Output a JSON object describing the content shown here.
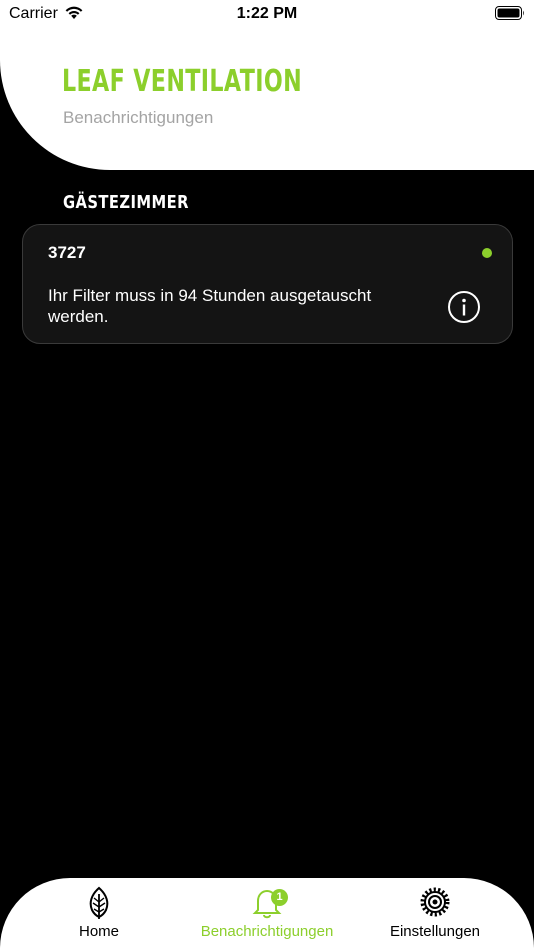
{
  "status_bar": {
    "carrier": "Carrier",
    "time": "1:22 PM"
  },
  "header": {
    "title": "LEAF VENTILATION",
    "subtitle": "Benachrichtigungen"
  },
  "section": {
    "title": "GÄSTEZIMMER"
  },
  "notifications": [
    {
      "device_id": "3727",
      "message": "Ihr Filter muss in 94 Stunden ausgetauscht werden.",
      "status_color": "#8ccf2c"
    }
  ],
  "tabbar": {
    "tabs": [
      {
        "label": "Home",
        "icon": "leaf-icon",
        "active": false
      },
      {
        "label": "Benachrichtigungen",
        "icon": "bell-icon",
        "active": true,
        "badge": "1"
      },
      {
        "label": "Einstellungen",
        "icon": "gear-icon",
        "active": false
      }
    ]
  },
  "colors": {
    "accent": "#8ccf2c",
    "background": "#000000",
    "card": "#141414",
    "subtitle": "#a4a4a4"
  }
}
